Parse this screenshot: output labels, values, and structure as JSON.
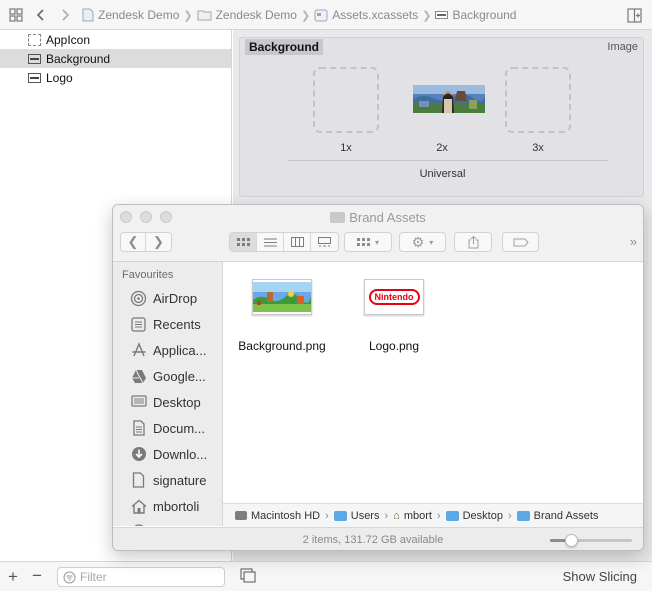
{
  "jumpbar": {
    "crumbs": [
      "Zendesk Demo",
      "Zendesk Demo",
      "Assets.xcassets",
      "Background"
    ]
  },
  "navigator": {
    "items": [
      {
        "label": "AppIcon",
        "icon": "appicon-icon"
      },
      {
        "label": "Background",
        "icon": "image-set-icon",
        "selected": true
      },
      {
        "label": "Logo",
        "icon": "image-set-icon"
      }
    ],
    "filter_placeholder": "Filter"
  },
  "asset": {
    "name": "Background",
    "type": "Image",
    "slots": [
      "1x",
      "2x",
      "3x"
    ],
    "group_label": "Universal"
  },
  "bottom": {
    "show_slicing": "Show Slicing"
  },
  "finder": {
    "title": "Brand Assets",
    "sidebar_section": "Favourites",
    "sidebar": [
      {
        "label": "AirDrop",
        "icon": "airdrop-icon"
      },
      {
        "label": "Recents",
        "icon": "recents-icon"
      },
      {
        "label": "Applica...",
        "icon": "applications-icon"
      },
      {
        "label": "Google...",
        "icon": "google-drive-icon"
      },
      {
        "label": "Desktop",
        "icon": "desktop-icon"
      },
      {
        "label": "Docum...",
        "icon": "documents-icon"
      },
      {
        "label": "Downlo...",
        "icon": "downloads-icon"
      },
      {
        "label": "signature",
        "icon": "document-icon"
      },
      {
        "label": "mbortoli",
        "icon": "home-icon"
      }
    ],
    "files": [
      {
        "name": "Background.png",
        "thumb": "landscape-thumbnail"
      },
      {
        "name": "Logo.png",
        "thumb": "logo-thumbnail",
        "thumb_text": "Nintendo"
      }
    ],
    "path": [
      "Macintosh HD",
      "Users",
      "mbortoli",
      "Desktop",
      "Brand Assets"
    ],
    "path_truncated": "mbort",
    "status": "2 items, 131.72 GB available",
    "icon_size_fraction": 0.25
  },
  "colors": {
    "selection": "#dcdcdc",
    "folder_blue": "#5aa8e6",
    "nintendo_red": "#e60012"
  }
}
